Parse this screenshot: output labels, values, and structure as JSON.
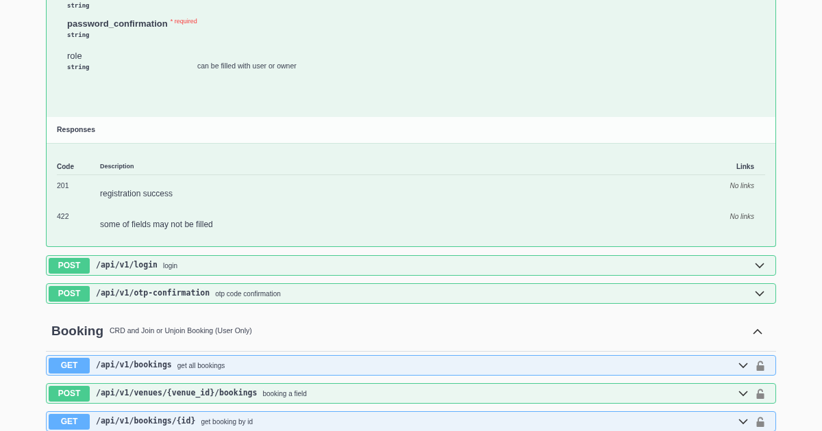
{
  "open_operation": {
    "parameters": [
      {
        "type": "string"
      },
      {
        "name": "password_confirmation",
        "required": true,
        "required_label": "* required",
        "type": "string"
      },
      {
        "name": "role",
        "required": false,
        "type": "string",
        "description": "can be filled with user or owner"
      }
    ],
    "responses": {
      "title": "Responses",
      "columns": [
        "Code",
        "Description",
        "Links"
      ],
      "rows": [
        {
          "code": "201",
          "description": "registration success",
          "links": "No links"
        },
        {
          "code": "422",
          "description": "some of fields may not be filled",
          "links": "No links"
        }
      ]
    }
  },
  "operations": [
    {
      "method": "POST",
      "path": "/api/v1/login",
      "summary": "login",
      "locked": false
    },
    {
      "method": "POST",
      "path": "/api/v1/otp-confirmation",
      "summary": "otp code confirmation",
      "locked": false
    }
  ],
  "section": {
    "title": "Booking",
    "description": "CRD and Join or Unjoin Booking (User Only)",
    "expanded": true
  },
  "section_operations": [
    {
      "method": "GET",
      "path": "/api/v1/bookings",
      "summary": "get all bookings",
      "locked": true
    },
    {
      "method": "POST",
      "path": "/api/v1/venues/{venue_id}/bookings",
      "summary": "booking a field",
      "locked": true
    },
    {
      "method": "GET",
      "path": "/api/v1/bookings/{id}",
      "summary": "get booking by id",
      "locked": true
    }
  ]
}
